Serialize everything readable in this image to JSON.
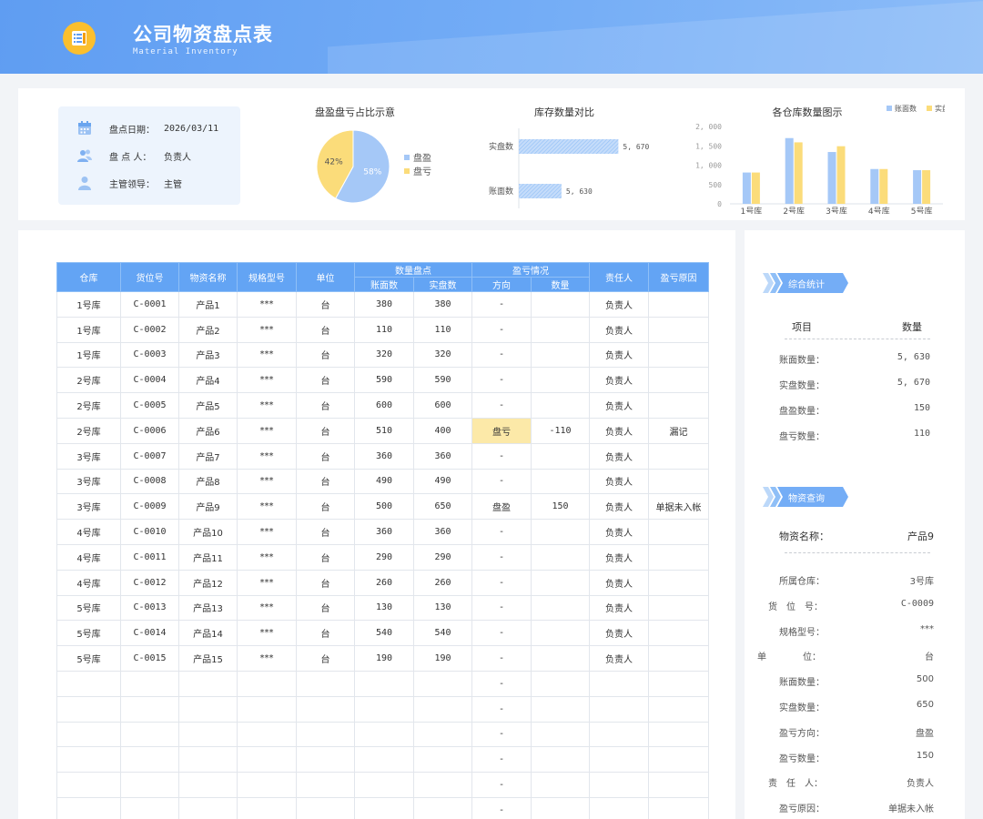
{
  "header": {
    "title": "公司物资盘点表",
    "subtitle": "Material Inventory",
    "logo_icon": "document-list-icon"
  },
  "info": {
    "rows": [
      {
        "icon": "calendar-icon",
        "label": "盘点日期：",
        "value": "2026/03/11"
      },
      {
        "icon": "users-icon",
        "label": "盘 点 人：",
        "value": "负责人"
      },
      {
        "icon": "user-icon",
        "label": "主管领导：",
        "value": "主管"
      }
    ]
  },
  "colors": {
    "accent": "#63a4f4",
    "blue": "#a5c8f7",
    "yellow": "#fbdc7a",
    "highlight": "#fce9a8"
  },
  "chart_data": [
    {
      "type": "pie",
      "title": "盘盈盘亏占比示意",
      "slices": [
        {
          "name": "盘盈",
          "value": 58,
          "label": "58%",
          "color": "#a5c8f7"
        },
        {
          "name": "盘亏",
          "value": 42,
          "label": "42%",
          "color": "#fbdc7a"
        }
      ],
      "legend": "right"
    },
    {
      "type": "bar",
      "orientation": "horizontal",
      "title": "库存数量对比",
      "categories": [
        "实盘数",
        "账面数"
      ],
      "values": [
        5670,
        5630
      ],
      "value_labels": [
        "5, 670",
        "5, 630"
      ],
      "xlim": [
        5600,
        5680
      ]
    },
    {
      "type": "bar",
      "title": "各仓库数量图示",
      "categories": [
        "1号库",
        "2号库",
        "3号库",
        "4号库",
        "5号库"
      ],
      "series": [
        {
          "name": "账面数",
          "values": [
            810,
            1700,
            1340,
            900,
            870
          ],
          "color": "#a5c8f7"
        },
        {
          "name": "实盘数",
          "values": [
            810,
            1590,
            1490,
            900,
            870
          ],
          "color": "#fbdc7a"
        }
      ],
      "yticks": [
        "2, 000",
        "1, 500",
        "1, 000",
        "500",
        "0"
      ],
      "ylim": [
        0,
        2000
      ],
      "legend": "top-right"
    }
  ],
  "table": {
    "headers": {
      "warehouse": "仓库",
      "code": "货位号",
      "name": "物资名称",
      "spec": "规格型号",
      "unit": "单位",
      "qty_group": "数量盘点",
      "book": "账面数",
      "actual": "实盘数",
      "diff_group": "盈亏情况",
      "direction": "方向",
      "diff_qty": "数量",
      "owner": "责任人",
      "reason": "盈亏原因"
    },
    "rows": [
      [
        "1号库",
        "C-0001",
        "产品1",
        "***",
        "台",
        "380",
        "380",
        "-",
        "",
        "负责人",
        ""
      ],
      [
        "1号库",
        "C-0002",
        "产品2",
        "***",
        "台",
        "110",
        "110",
        "-",
        "",
        "负责人",
        ""
      ],
      [
        "1号库",
        "C-0003",
        "产品3",
        "***",
        "台",
        "320",
        "320",
        "-",
        "",
        "负责人",
        ""
      ],
      [
        "2号库",
        "C-0004",
        "产品4",
        "***",
        "台",
        "590",
        "590",
        "-",
        "",
        "负责人",
        ""
      ],
      [
        "2号库",
        "C-0005",
        "产品5",
        "***",
        "台",
        "600",
        "600",
        "-",
        "",
        "负责人",
        ""
      ],
      [
        "2号库",
        "C-0006",
        "产品6",
        "***",
        "台",
        "510",
        "400",
        "盘亏",
        "-110",
        "负责人",
        "漏记"
      ],
      [
        "3号库",
        "C-0007",
        "产品7",
        "***",
        "台",
        "360",
        "360",
        "-",
        "",
        "负责人",
        ""
      ],
      [
        "3号库",
        "C-0008",
        "产品8",
        "***",
        "台",
        "490",
        "490",
        "-",
        "",
        "负责人",
        ""
      ],
      [
        "3号库",
        "C-0009",
        "产品9",
        "***",
        "台",
        "500",
        "650",
        "盘盈",
        "150",
        "负责人",
        "单据未入帐"
      ],
      [
        "4号库",
        "C-0010",
        "产品10",
        "***",
        "台",
        "360",
        "360",
        "-",
        "",
        "负责人",
        ""
      ],
      [
        "4号库",
        "C-0011",
        "产品11",
        "***",
        "台",
        "290",
        "290",
        "-",
        "",
        "负责人",
        ""
      ],
      [
        "4号库",
        "C-0012",
        "产品12",
        "***",
        "台",
        "260",
        "260",
        "-",
        "",
        "负责人",
        ""
      ],
      [
        "5号库",
        "C-0013",
        "产品13",
        "***",
        "台",
        "130",
        "130",
        "-",
        "",
        "负责人",
        ""
      ],
      [
        "5号库",
        "C-0014",
        "产品14",
        "***",
        "台",
        "540",
        "540",
        "-",
        "",
        "负责人",
        ""
      ],
      [
        "5号库",
        "C-0015",
        "产品15",
        "***",
        "台",
        "190",
        "190",
        "-",
        "",
        "负责人",
        ""
      ],
      [
        "",
        "",
        "",
        "",
        "",
        "",
        "",
        "-",
        "",
        "",
        ""
      ],
      [
        "",
        "",
        "",
        "",
        "",
        "",
        "",
        "-",
        "",
        "",
        ""
      ],
      [
        "",
        "",
        "",
        "",
        "",
        "",
        "",
        "-",
        "",
        "",
        ""
      ],
      [
        "",
        "",
        "",
        "",
        "",
        "",
        "",
        "-",
        "",
        "",
        ""
      ],
      [
        "",
        "",
        "",
        "",
        "",
        "",
        "",
        "-",
        "",
        "",
        ""
      ],
      [
        "",
        "",
        "",
        "",
        "",
        "",
        "",
        "-",
        "",
        "",
        ""
      ]
    ]
  },
  "summary": {
    "ribbon": "综合统计",
    "col_item": "项目",
    "col_qty": "数量",
    "rows": [
      {
        "label": "账面数量：",
        "value": "5, 630"
      },
      {
        "label": "实盘数量：",
        "value": "5, 670"
      },
      {
        "label": "盘盈数量：",
        "value": "150"
      },
      {
        "label": "盘亏数量：",
        "value": "110"
      }
    ]
  },
  "lookup": {
    "ribbon": "物资查询",
    "name_label": "物资名称：",
    "name_value": "产品9",
    "rows": [
      {
        "label": "所属仓库：",
        "value": "3号库"
      },
      {
        "label": "货　位　号：",
        "value": "C-0009"
      },
      {
        "label": "规格型号：",
        "value": "***"
      },
      {
        "label": "单　　　　位：",
        "value": "台"
      },
      {
        "label": "账面数量：",
        "value": "500"
      },
      {
        "label": "实盘数量：",
        "value": "650"
      },
      {
        "label": "盈亏方向：",
        "value": "盘盈"
      },
      {
        "label": "盈亏数量：",
        "value": "150"
      },
      {
        "label": "责　任　人：",
        "value": "负责人"
      },
      {
        "label": "盈亏原因：",
        "value": "单据未入帐"
      }
    ]
  }
}
